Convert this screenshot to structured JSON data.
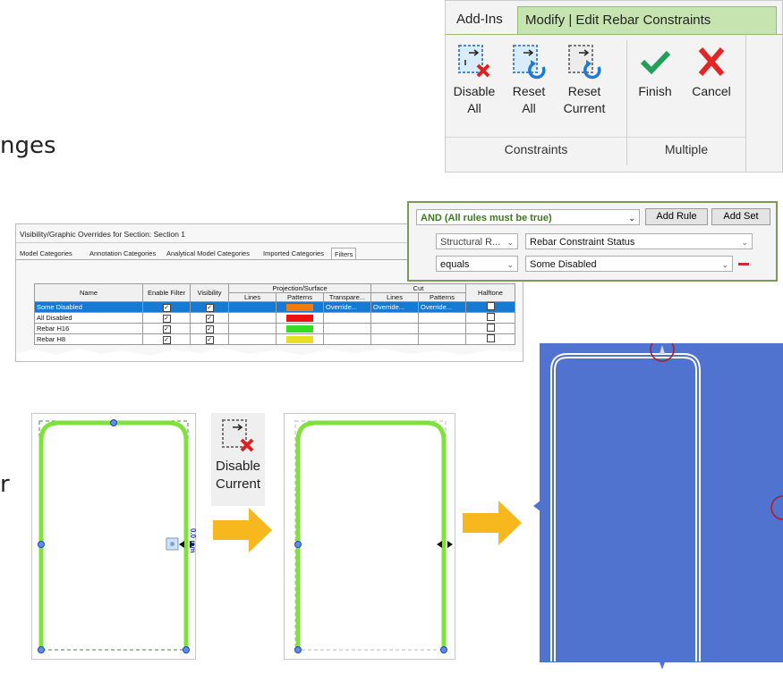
{
  "slide": {
    "fragment_top": "nges",
    "fragment_mid": "r"
  },
  "ribbon": {
    "tabs": [
      "Add-Ins",
      "Modify | Edit Rebar Constraints"
    ],
    "buttons": [
      {
        "label_line1": "Disable",
        "label_line2": "All"
      },
      {
        "label_line1": "Reset",
        "label_line2": "All"
      },
      {
        "label_line1": "Reset",
        "label_line2": "Current"
      },
      {
        "label_line1": "Finish",
        "label_line2": ""
      },
      {
        "label_line1": "Cancel",
        "label_line2": ""
      }
    ],
    "groups": [
      "Constraints",
      "Multiple"
    ]
  },
  "filter_rules": {
    "condition": "AND (All rules must be true)",
    "add_rule": "Add Rule",
    "add_set": "Add Set",
    "rule_category": "Structural R...",
    "rule_parameter": "Rebar Constraint Status",
    "rule_operator": "equals",
    "rule_value": "Some Disabled"
  },
  "vg_dialog": {
    "title": "Visibility/Graphic Overrides for Section: Section 1",
    "tabs": [
      "Model Categories",
      "Annotation Categories",
      "Analytical Model Categories",
      "Imported Categories",
      "Filters"
    ],
    "headers": {
      "name": "Name",
      "enable_filter": "Enable Filter",
      "visibility": "Visibility",
      "projection_surface": "Projection/Surface",
      "cut": "Cut",
      "halftone": "Halftone",
      "lines": "Lines",
      "patterns": "Patterns",
      "transparency": "Transpare...",
      "cut_lines": "Lines",
      "cut_patterns": "Patterns"
    },
    "rows": [
      {
        "name": "Some Disabled",
        "color": "#f07d0a",
        "transparency": "Override...",
        "cut_lines": "Override...",
        "cut_patterns": "Override..."
      },
      {
        "name": "All Disabled",
        "color": "#ee1111",
        "transparency": "",
        "cut_lines": "",
        "cut_patterns": ""
      },
      {
        "name": "Rebar H16",
        "color": "#33dd22",
        "transparency": "",
        "cut_lines": "",
        "cut_patterns": ""
      },
      {
        "name": "Rebar H8",
        "color": "#e8e020",
        "transparency": "",
        "cut_lines": "",
        "cut_patterns": ""
      }
    ]
  },
  "disable_current": {
    "label_line1": "Disable",
    "label_line2": "Current"
  },
  "dimension_label": "0.0 mm",
  "colors": {
    "rebar_green": "#7ee23a",
    "arrow_orange": "#f7b81e",
    "blue_section": "#4f73cf",
    "accent_red": "#b01c1c"
  }
}
